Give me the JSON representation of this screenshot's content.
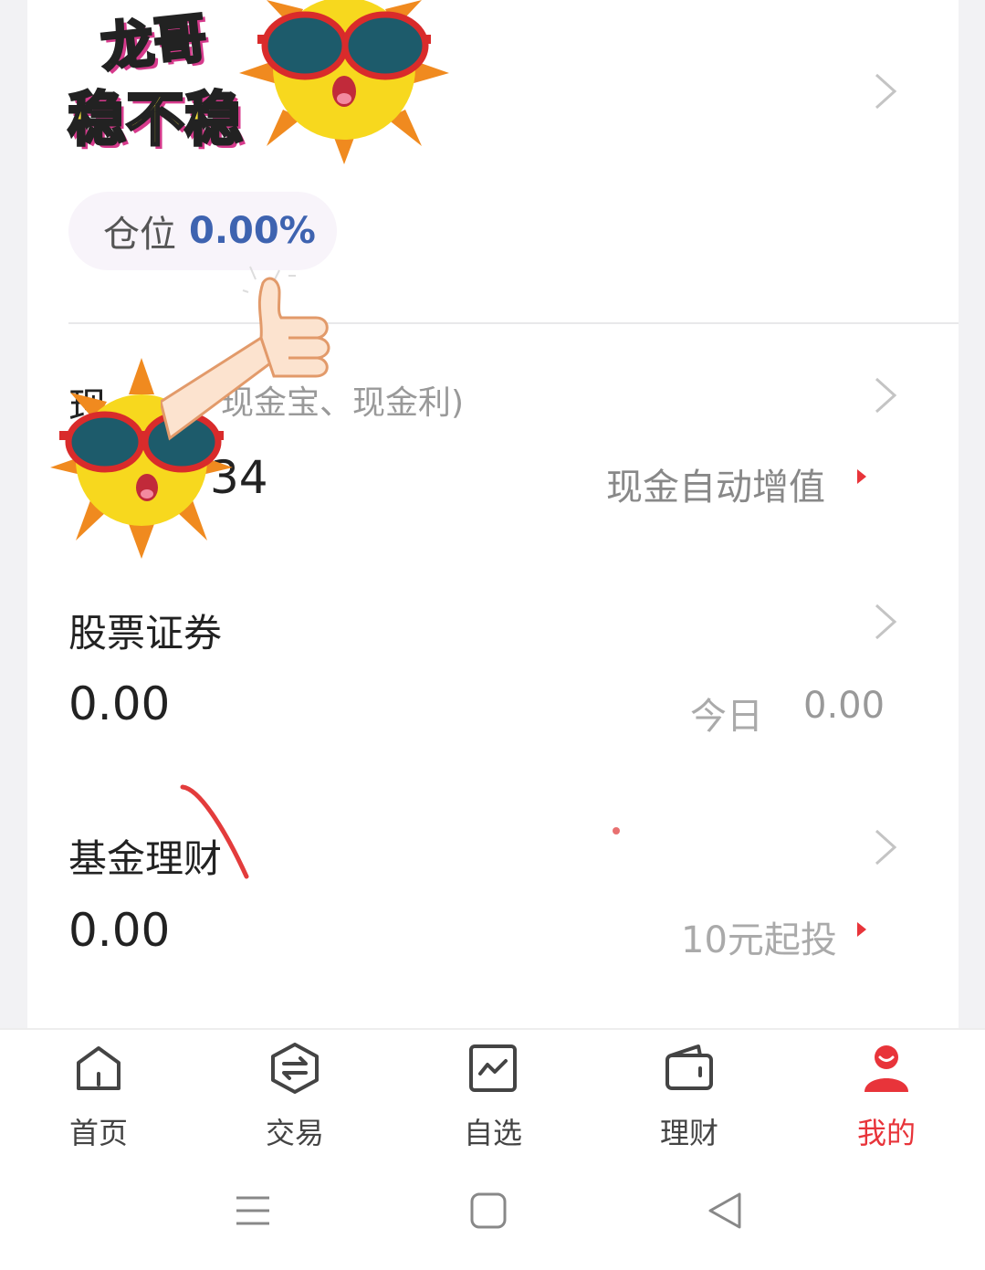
{
  "position": {
    "label": "仓位",
    "value": "0.00%"
  },
  "cash": {
    "title_visible": "现",
    "subtitle_visible": "现金宝、现金利)",
    "amount_visible": "34",
    "promo": "现金自动增值"
  },
  "stocks": {
    "title": "股票证券",
    "amount": "0.00",
    "today_label": "今日",
    "today_value": "0.00"
  },
  "funds": {
    "title": "基金理财",
    "amount": "0.00",
    "promo": "10元起投"
  },
  "sticker": {
    "text_line1": "龙哥",
    "text_line2": "稳不稳"
  },
  "nav": {
    "items": [
      {
        "label": "首页",
        "icon": "home-icon"
      },
      {
        "label": "交易",
        "icon": "exchange-icon"
      },
      {
        "label": "自选",
        "icon": "watchlist-chart-icon"
      },
      {
        "label": "理财",
        "icon": "wallet-icon"
      },
      {
        "label": "我的",
        "icon": "profile-icon"
      }
    ],
    "active_index": 4,
    "active_color": "#e8343a"
  },
  "system_nav": {
    "icons": [
      "menu-icon",
      "home-square-icon",
      "back-triangle-icon"
    ]
  },
  "colors": {
    "accent_red": "#e8343a",
    "position_blue": "#3e63b0"
  }
}
